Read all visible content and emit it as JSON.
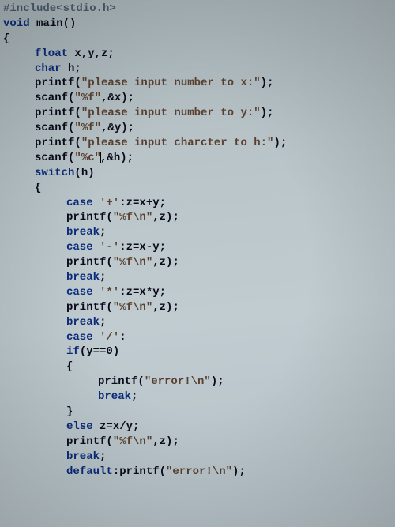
{
  "code": {
    "line1": "#include<stdio.h>",
    "line2_kw": "void",
    "line2_rest": " main()",
    "line3": "{",
    "line4_kw": "float",
    "line4_rest": " x,y,z;",
    "line5_kw": "char",
    "line5_rest": " h;",
    "line6_fn": "printf(",
    "line6_str": "\"please input number to x:\"",
    "line6_end": ");",
    "line7_fn": "scanf(",
    "line7_str": "\"%f\"",
    "line7_end": ",&x);",
    "line8_fn": "printf(",
    "line8_str": "\"please input number to y:\"",
    "line8_end": ");",
    "line9_fn": "scanf(",
    "line9_str": "\"%f\"",
    "line9_end": ",&y);",
    "line10_fn": "printf(",
    "line10_str": "\"please input charcter to h:\"",
    "line10_end": ");",
    "line11_fn": "scanf(",
    "line11_str": "\"%c\"",
    "line11_end": ",&h);",
    "line12_kw": "switch",
    "line12_rest": "(h)",
    "line13": "{",
    "line14_kw": "case",
    "line14_ch": " '+'",
    "line14_rest": ":z=x+y;",
    "line15_fn": "printf(",
    "line15_str": "\"%f\\n\"",
    "line15_end": ",z);",
    "line16_kw": "break",
    "line16_rest": ";",
    "line17_kw": "case",
    "line17_ch": " '-'",
    "line17_rest": ":z=x-y;",
    "line18_fn": "printf(",
    "line18_str": "\"%f\\n\"",
    "line18_end": ",z);",
    "line19_kw": "break",
    "line19_rest": ";",
    "line20_kw": "case",
    "line20_ch": " '*'",
    "line20_rest": ":z=x*y;",
    "line21_fn": "printf(",
    "line21_str": "\"%f\\n\"",
    "line21_end": ",z);",
    "line22_kw": "break",
    "line22_rest": ";",
    "line23_kw": "case",
    "line23_ch": " '/'",
    "line23_rest": ":",
    "line24_kw": "if",
    "line24_rest": "(y==0)",
    "line25": "{",
    "line26_fn": "printf(",
    "line26_str": "\"error!\\n\"",
    "line26_end": ");",
    "line27_kw": "break",
    "line27_rest": ";",
    "line28": "}",
    "line29_kw": "else",
    "line29_rest": " z=x/y;",
    "line30_fn": "printf(",
    "line30_str": "\"%f\\n\"",
    "line30_end": ",z);",
    "line31_kw": "break",
    "line31_rest": ";",
    "line32_kw": "default",
    "line32_rest": ":printf(",
    "line32_str": "\"error!\\n\"",
    "line32_end": ");"
  }
}
